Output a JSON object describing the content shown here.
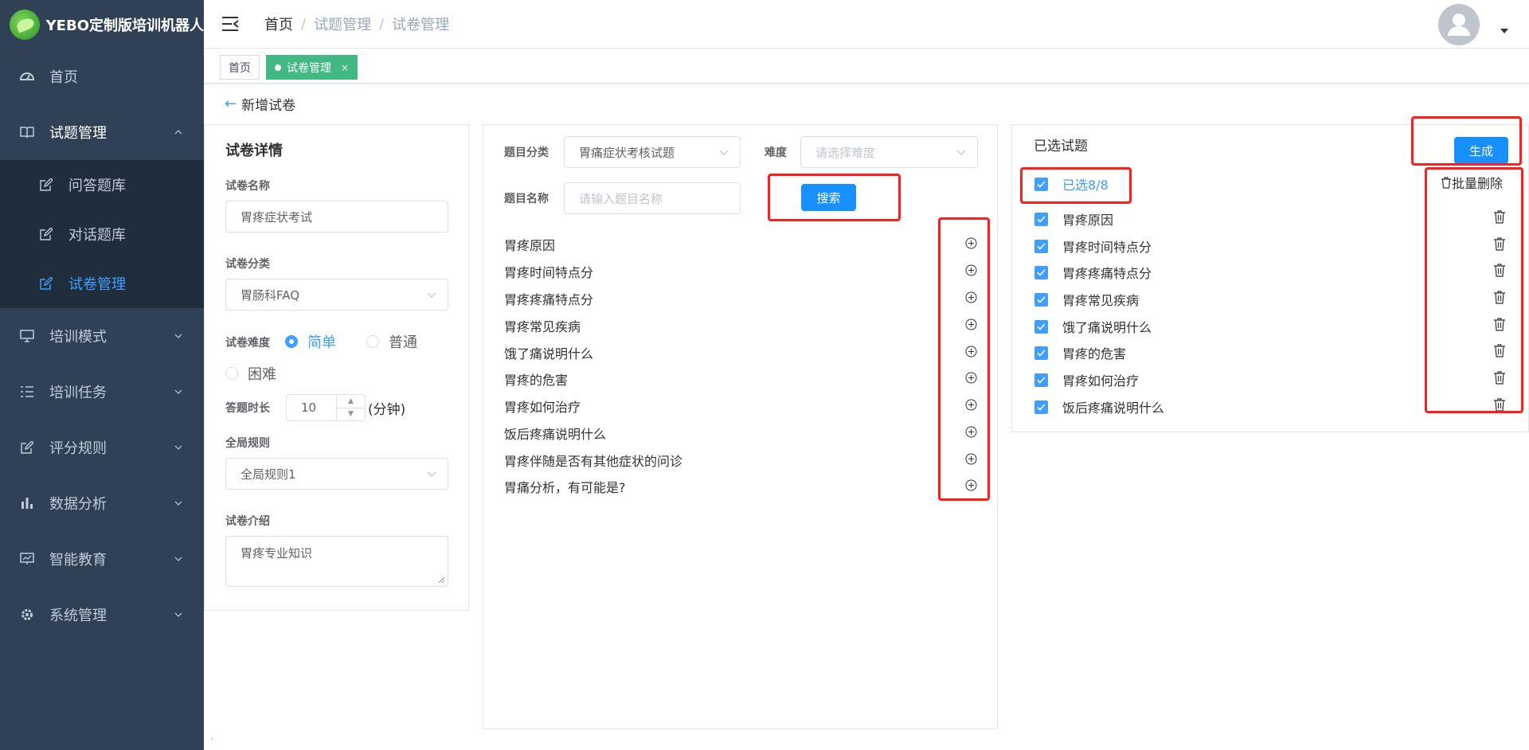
{
  "app": {
    "title": "YEBO定制版培训机器人"
  },
  "sidebar": {
    "items": [
      {
        "label": "首页",
        "icon": "dashboard-icon"
      },
      {
        "label": "试题管理",
        "icon": "book-icon",
        "open": true,
        "children": [
          {
            "label": "问答题库",
            "icon": "edit-icon"
          },
          {
            "label": "对话题库",
            "icon": "edit-icon"
          },
          {
            "label": "试卷管理",
            "icon": "edit-icon",
            "active": true
          }
        ]
      },
      {
        "label": "培训模式",
        "icon": "monitor-icon"
      },
      {
        "label": "培训任务",
        "icon": "list-icon"
      },
      {
        "label": "评分规则",
        "icon": "edit-icon"
      },
      {
        "label": "数据分析",
        "icon": "bar-chart-icon"
      },
      {
        "label": "智能教育",
        "icon": "screen-icon"
      },
      {
        "label": "系统管理",
        "icon": "gear-icon"
      }
    ]
  },
  "header": {
    "breadcrumb": [
      "首页",
      "试题管理",
      "试卷管理"
    ]
  },
  "tags": {
    "home": "首页",
    "active": "试卷管理",
    "close": "×"
  },
  "page": {
    "back_title": "新增试卷"
  },
  "detail": {
    "title": "试卷详情",
    "name_label": "试卷名称",
    "name_value": "胃疼症状考试",
    "category_label": "试卷分类",
    "category_value": "胃肠科FAQ",
    "difficulty_label": "试卷难度",
    "difficulty_options": [
      "简单",
      "普通",
      "困难"
    ],
    "difficulty_selected": "简单",
    "duration_label": "答题时长",
    "duration_value": "10",
    "duration_unit": "(分钟)",
    "rule_label": "全局规则",
    "rule_value": "全局规则1",
    "intro_label": "试卷介绍",
    "intro_value": "胃疼专业知识"
  },
  "search": {
    "category_label": "题目分类",
    "category_value": "胃痛症状考核试题",
    "difficulty_label": "难度",
    "difficulty_placeholder": "请选择难度",
    "name_label": "题目名称",
    "name_placeholder": "请输入题目名称",
    "search_button": "搜索"
  },
  "questions": [
    "胃疼原因",
    "胃疼时间特点分",
    "胃疼疼痛特点分",
    "胃疼常见疾病",
    "饿了痛说明什么",
    "胃疼的危害",
    "胃疼如何治疗",
    "饭后疼痛说明什么",
    "胃疼伴随是否有其他症状的问诊",
    "胃痛分析，有可能是?"
  ],
  "selected": {
    "title": "已选试题",
    "generate_button": "生成",
    "select_all_label": "已选8/8",
    "batch_delete": "批量删除",
    "items": [
      "胃疼原因",
      "胃疼时间特点分",
      "胃疼疼痛特点分",
      "胃疼常见疾病",
      "饿了痛说明什么",
      "胃疼的危害",
      "胃疼如何治疗",
      "饭后疼痛说明什么"
    ]
  },
  "footer": {
    "mark": "."
  },
  "colors": {
    "sidebar_bg": "#304156",
    "submenu_bg": "#1f2d3d",
    "active": "#409eff",
    "primary_button": "#1890ff",
    "tag_active": "#42b983",
    "highlight_box": "#ff1e1e"
  }
}
